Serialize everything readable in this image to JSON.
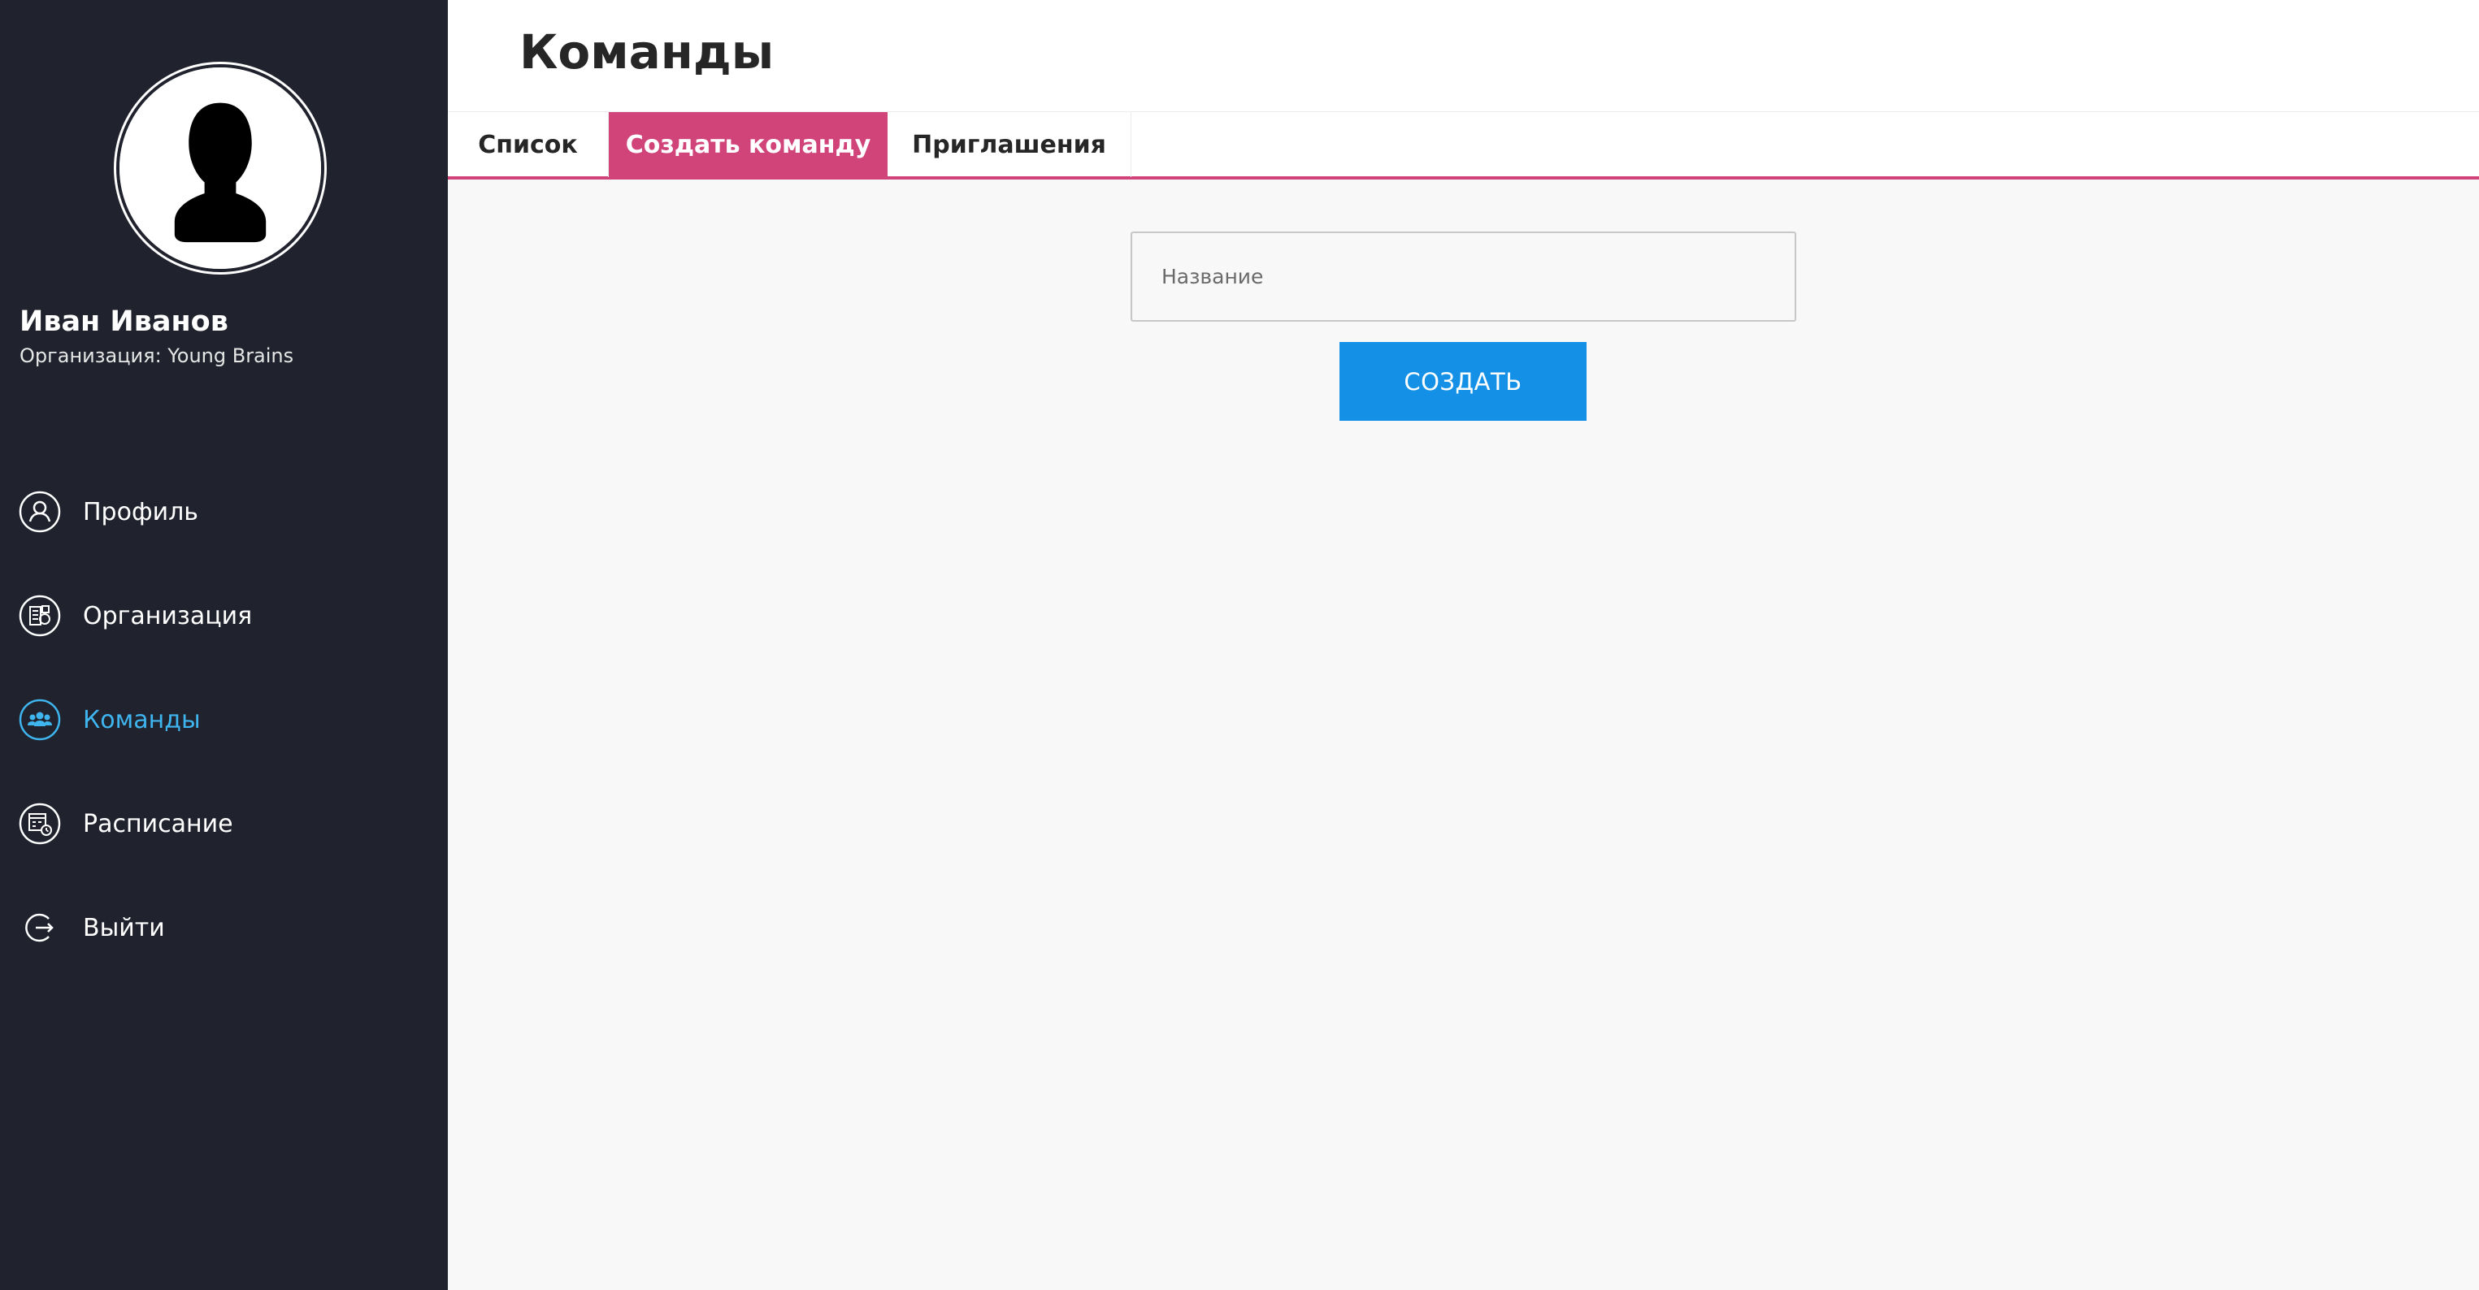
{
  "sidebar": {
    "user_name": "Иван Иванов",
    "organization": "Организация: Young Brains",
    "items": [
      {
        "label": "Профиль",
        "icon": "user-icon"
      },
      {
        "label": "Организация",
        "icon": "organization-icon"
      },
      {
        "label": "Команды",
        "icon": "team-icon",
        "active": true
      },
      {
        "label": "Расписание",
        "icon": "calendar-icon"
      },
      {
        "label": "Выйти",
        "icon": "logout-icon"
      }
    ]
  },
  "header": {
    "title": "Команды"
  },
  "tabs": [
    {
      "label": "Список"
    },
    {
      "label": "Создать команду",
      "active": true
    },
    {
      "label": "Приглашения"
    }
  ],
  "form": {
    "name_placeholder": "Название",
    "name_value": "",
    "submit_label": "СОЗДАТЬ"
  },
  "colors": {
    "sidebar_bg": "#20232d",
    "accent_pink": "#d1447a",
    "primary_blue": "#1491e6",
    "active_nav": "#3fb5f0"
  }
}
